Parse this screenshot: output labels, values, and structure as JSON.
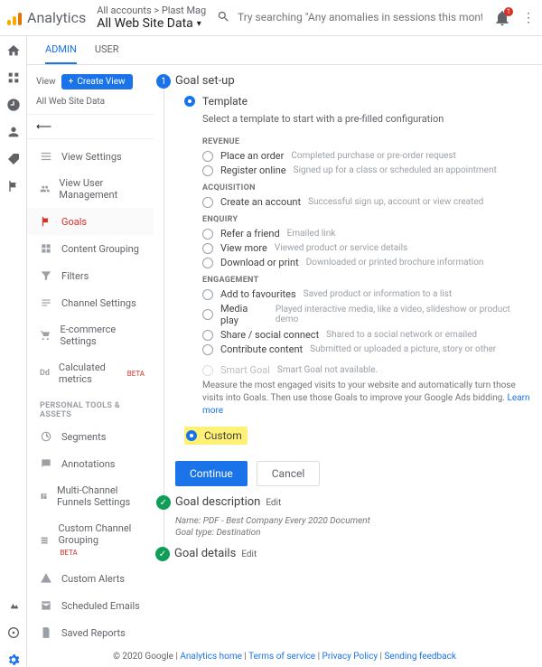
{
  "header": {
    "product": "Analytics",
    "account_line": "All accounts > Plast Mag",
    "property": "All Web Site Data",
    "search_placeholder": "Try searching \"Any anomalies in sessions this month?\"",
    "notif_count": "1"
  },
  "tabs": {
    "admin": "ADMIN",
    "user": "USER"
  },
  "view_panel": {
    "label": "View",
    "create_btn": "Create View",
    "view_name": "All Web Site Data"
  },
  "sidebar": {
    "items": [
      "View Settings",
      "View User Management",
      "Goals",
      "Content Grouping",
      "Filters",
      "Channel Settings",
      "E-commerce Settings",
      "Calculated metrics"
    ],
    "beta": "BETA",
    "tools_header": "PERSONAL TOOLS & ASSETS",
    "tools": [
      "Segments",
      "Annotations",
      "Multi-Channel Funnels Settings",
      "Custom Channel Grouping",
      "Custom Alerts",
      "Scheduled Emails",
      "Saved Reports"
    ]
  },
  "step1": {
    "num": "1",
    "title": "Goal set-up",
    "template_label": "Template",
    "template_desc": "Select a template to start with a pre-filled configuration",
    "cats": {
      "revenue": "REVENUE",
      "acquisition": "ACQUISITION",
      "enquiry": "ENQUIRY",
      "engagement": "ENGAGEMENT"
    },
    "templates": {
      "revenue": [
        {
          "name": "Place an order",
          "hint": "Completed purchase or pre-order request"
        },
        {
          "name": "Register online",
          "hint": "Signed up for a class or scheduled an appointment"
        }
      ],
      "acquisition": [
        {
          "name": "Create an account",
          "hint": "Successful sign up, account or view created"
        }
      ],
      "enquiry": [
        {
          "name": "Refer a friend",
          "hint": "Emailed link"
        },
        {
          "name": "View more",
          "hint": "Viewed product or service details"
        },
        {
          "name": "Download or print",
          "hint": "Downloaded or printed brochure information"
        }
      ],
      "engagement": [
        {
          "name": "Add to favourites",
          "hint": "Saved product or information to a list"
        },
        {
          "name": "Media play",
          "hint": "Played interactive media, like a video, slideshow or product demo"
        },
        {
          "name": "Share / social connect",
          "hint": "Shared to a social network or emailed"
        },
        {
          "name": "Contribute content",
          "hint": "Submitted or uploaded a picture, story or other"
        }
      ]
    },
    "smart_label": "Smart Goal",
    "smart_na": "Smart Goal not available.",
    "smart_desc": "Measure the most engaged visits to your website and automatically turn those visits into Goals. Then use those Goals to improve your Google Ads bidding.",
    "learn_more": "Learn more",
    "custom_label": "Custom",
    "continue": "Continue",
    "cancel": "Cancel"
  },
  "step2": {
    "title": "Goal description",
    "edit": "Edit",
    "name_line": "Name: PDF - Best Company Every 2020 Document",
    "type_line": "Goal type: Destination"
  },
  "step3": {
    "title": "Goal details",
    "edit": "Edit"
  },
  "footer": {
    "copyright": "© 2020 Google",
    "links": [
      "Analytics home",
      "Terms of service",
      "Privacy Policy",
      "Sending feedback"
    ]
  }
}
